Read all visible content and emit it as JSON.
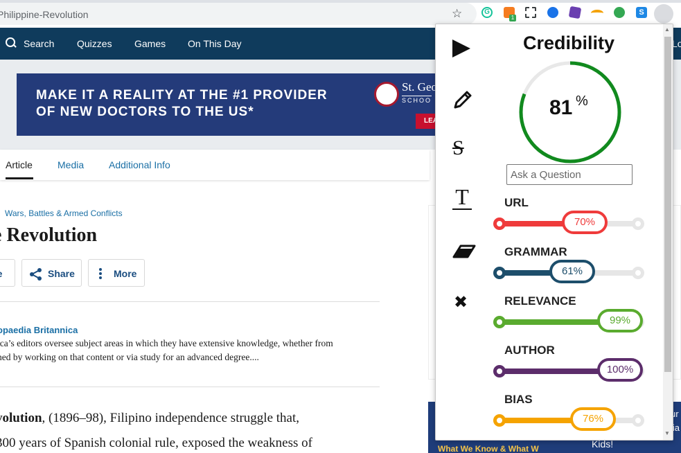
{
  "browser": {
    "url": "Philippine-Revolution",
    "star_icon": "star-icon",
    "extensions": [
      "grammarly-icon",
      "extension-badge-icon",
      "crop-icon",
      "bookmark-icon",
      "cube-icon",
      "rainbow-icon",
      "chat-icon",
      "s-icon"
    ],
    "extension_badge": "1",
    "s_label": "S"
  },
  "site_nav": {
    "items": [
      "Search",
      "Quizzes",
      "Games",
      "On This Day"
    ],
    "cut_item": "Lo"
  },
  "ad": {
    "headline_1": "MAKE IT A REALITY AT THE #1 PROVIDER",
    "headline_2": "OF NEW DOCTORS TO THE US*",
    "brand": "St. Geo",
    "brand_sub": "SCHOO",
    "cta": "LEA"
  },
  "tabs": [
    "Article",
    "Media",
    "Additional Info"
  ],
  "article": {
    "breadcrumb": "Wars, Battles & Armed Conflicts",
    "title": "e Revolution",
    "buttons": {
      "cite": "te",
      "share": "Share",
      "more": "More"
    },
    "author_name": "opaedia Britannica",
    "author_desc_1": "ica’s editors oversee subject areas in which they have extensive knowledge, whether from",
    "author_desc_2": "ned by working on that content or via study for an advanced degree....",
    "body_bold": "volution",
    "body_1_rest": ", (1896–98), Filipino independence struggle that,",
    "body_2": "300 years of Spanish colonial rule, exposed the weakness of"
  },
  "promo": {
    "left": "What We Know & What W",
    "right": "Kids!",
    "cut_1": "ur",
    "cut_2": "lia"
  },
  "popup": {
    "title": "Credibility",
    "overall": 81,
    "overall_label": "81",
    "percent_sign": "%",
    "ask_placeholder": "Ask a Question",
    "tools": [
      "play-icon",
      "pencil-icon",
      "strikethrough-icon",
      "text-icon",
      "eraser-icon",
      "close-icon"
    ],
    "strike_glyph": "S",
    "text_glyph": "T",
    "close_glyph": "✖",
    "metrics": [
      {
        "label": "URL",
        "value": 70,
        "display": "70%",
        "color": "#ef3b3b"
      },
      {
        "label": "GRAMMAR",
        "value": 61,
        "display": "61%",
        "color": "#1d4e6b"
      },
      {
        "label": "RELEVANCE",
        "value": 99,
        "display": "99%",
        "color": "#5aab2f"
      },
      {
        "label": "AUTHOR",
        "value": 100,
        "display": "100%",
        "color": "#5c2d6b"
      },
      {
        "label": "BIAS",
        "value": 76,
        "display": "76%",
        "color": "#f5a300"
      }
    ],
    "gauge_color": "#118a1e",
    "gauge_track": "#e8e8e8"
  }
}
